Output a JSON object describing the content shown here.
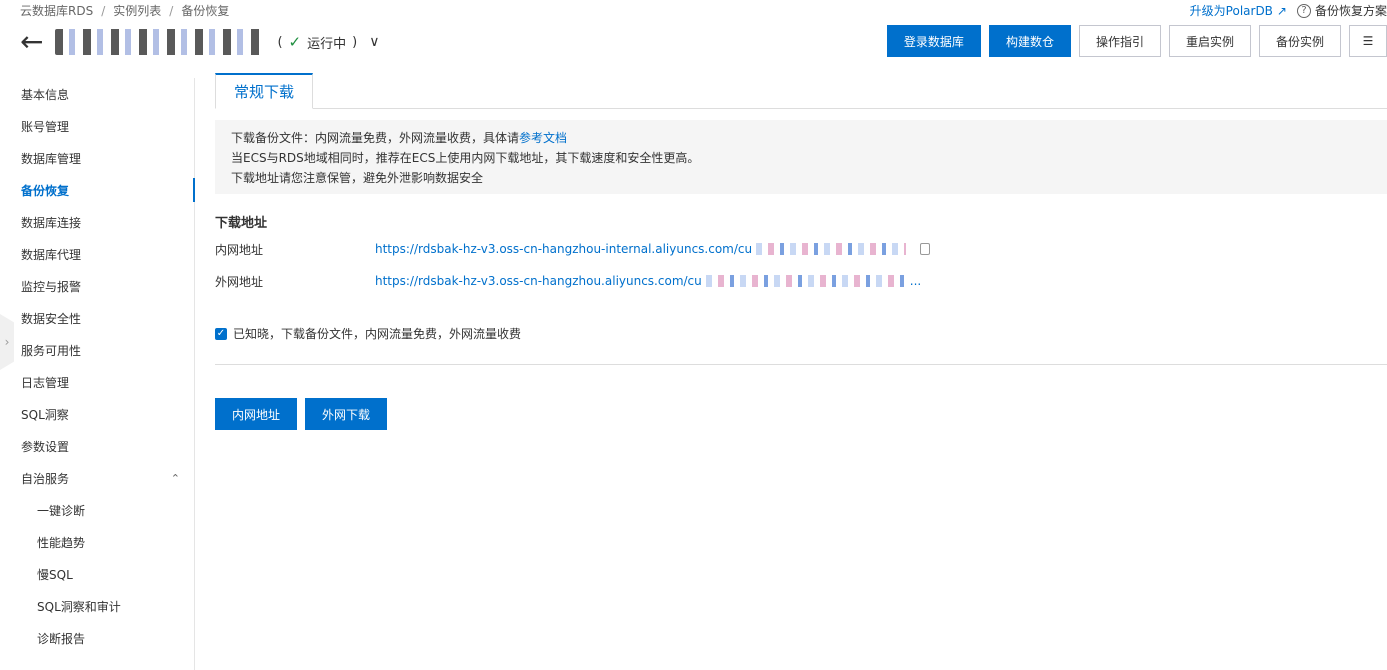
{
  "breadcrumb": [
    "云数据库RDS",
    "实例列表",
    "备份恢复"
  ],
  "top_links": {
    "upgrade": "升级为PolarDB",
    "help": "备份恢复方案",
    "help_glyph": "?"
  },
  "header": {
    "back_glyph": "←",
    "status": "运行中",
    "status_glyph": "✓",
    "status_open": "(",
    "status_close": ")",
    "chevron_glyph": "∨",
    "actions": [
      "登录数据库",
      "构建数仓",
      "操作指引",
      "重启实例",
      "备份实例"
    ],
    "extra_glyph": "☰"
  },
  "sidebar": {
    "toggle_glyph": "›",
    "caret_glyph": "⌃",
    "items": [
      "基本信息",
      "账号管理",
      "数据库管理",
      "备份恢复",
      "数据库连接",
      "数据库代理",
      "监控与报警",
      "数据安全性",
      "服务可用性",
      "日志管理",
      "SQL洞察",
      "参数设置",
      "自治服务"
    ],
    "subitems": [
      "一键诊断",
      "性能趋势",
      "慢SQL",
      "SQL洞察和审计",
      "诊断报告"
    ]
  },
  "main": {
    "tab": "常规下载",
    "notice": {
      "line1_prefix": "下载备份文件：内网流量免费，外网流量收费，具体请",
      "line1_link": "参考文档",
      "line2": "当ECS与RDS地域相同时，推荐在ECS上使用内网下载地址，其下载速度和安全性更高。",
      "line3": "下载地址请您注意保管，避免外泄影响数据安全"
    },
    "section_title": "下载地址",
    "internal_label": "内网地址",
    "internal_url": "https://rdsbak-hz-v3.oss-cn-hangzhou-internal.aliyuncs.com/cu",
    "external_label": "外网地址",
    "external_url": "https://rdsbak-hz-v3.oss-cn-hangzhou.aliyuncs.com/cu",
    "external_ellipsis": "...",
    "agree_text": "已知晓，下载备份文件，内网流量免费，外网流量收费",
    "check_glyph": "✓",
    "buttons": [
      "内网地址",
      "外网下载"
    ]
  }
}
